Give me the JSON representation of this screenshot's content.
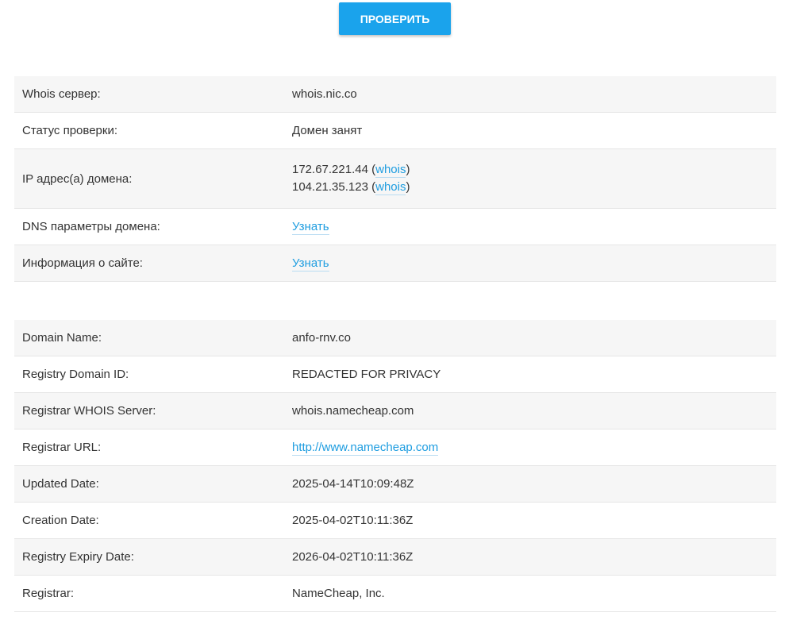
{
  "check_button_label": "ПРОВЕРИТЬ",
  "summary": {
    "whois_server": {
      "label": "Whois сервер:",
      "value": "whois.nic.co"
    },
    "status": {
      "label": "Статус проверки:",
      "value": "Домен занят"
    },
    "ip": {
      "label": "IP адрес(а) домена:",
      "addresses": [
        {
          "ip": "172.67.221.44",
          "open": " (",
          "link": "whois",
          "close": ")"
        },
        {
          "ip": "104.21.35.123",
          "open": " (",
          "link": "whois",
          "close": ")"
        }
      ]
    },
    "dns": {
      "label": "DNS параметры домена:",
      "link": "Узнать"
    },
    "site_info": {
      "label": "Информация о сайте:",
      "link": "Узнать"
    }
  },
  "whois": {
    "domain_name": {
      "label": "Domain Name:",
      "value": "anfo-rnv.co"
    },
    "registry_domain_id": {
      "label": "Registry Domain ID:",
      "value": "REDACTED FOR PRIVACY"
    },
    "registrar_whois_server": {
      "label": "Registrar WHOIS Server:",
      "value": "whois.namecheap.com"
    },
    "registrar_url": {
      "label": "Registrar URL:",
      "value": "http://www.namecheap.com"
    },
    "updated_date": {
      "label": "Updated Date:",
      "value": "2025-04-14T10:09:48Z"
    },
    "creation_date": {
      "label": "Creation Date:",
      "value": "2025-04-02T10:11:36Z"
    },
    "expiry_date": {
      "label": "Registry Expiry Date:",
      "value": "2026-04-02T10:11:36Z"
    },
    "registrar": {
      "label": "Registrar:",
      "value": "NameCheap, Inc."
    }
  },
  "colors": {
    "accent": "#1aa3ec",
    "link": "#1e9de0",
    "row_alt": "#f6f6f6",
    "border": "#e6e6e6"
  }
}
